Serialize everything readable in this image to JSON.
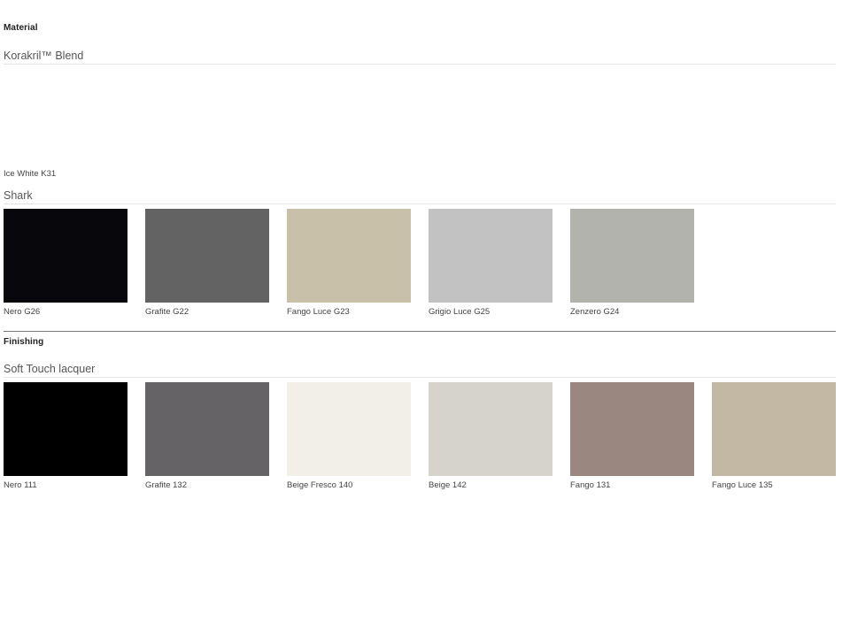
{
  "material": {
    "heading": "Material",
    "korakril": {
      "title": "Korakril™ Blend",
      "swatches": [
        {
          "label": "Ice White K31",
          "color": "#ffffff"
        }
      ]
    },
    "shark": {
      "title": "Shark",
      "swatches": [
        {
          "label": "Nero G26",
          "color": "#07070c"
        },
        {
          "label": "Grafite G22",
          "color": "#636363"
        },
        {
          "label": "Fango Luce G23",
          "color": "#c9c0aa"
        },
        {
          "label": "Grigio Luce G25",
          "color": "#c2c2c2"
        },
        {
          "label": "Zenzero G24",
          "color": "#b3b3ae"
        }
      ]
    }
  },
  "finishing": {
    "heading": "Finishing",
    "soft_touch": {
      "title": "Soft Touch lacquer",
      "swatches": [
        {
          "label": "Nero 111",
          "color": "#000000"
        },
        {
          "label": "Grafite 132",
          "color": "#656365"
        },
        {
          "label": "Beige Fresco 140",
          "color": "#f1efe7"
        },
        {
          "label": "Beige 142",
          "color": "#d6d3cc"
        },
        {
          "label": "Fango 131",
          "color": "#9a8880"
        },
        {
          "label": "Fango Luce 135",
          "color": "#c3b8a3"
        }
      ]
    }
  }
}
